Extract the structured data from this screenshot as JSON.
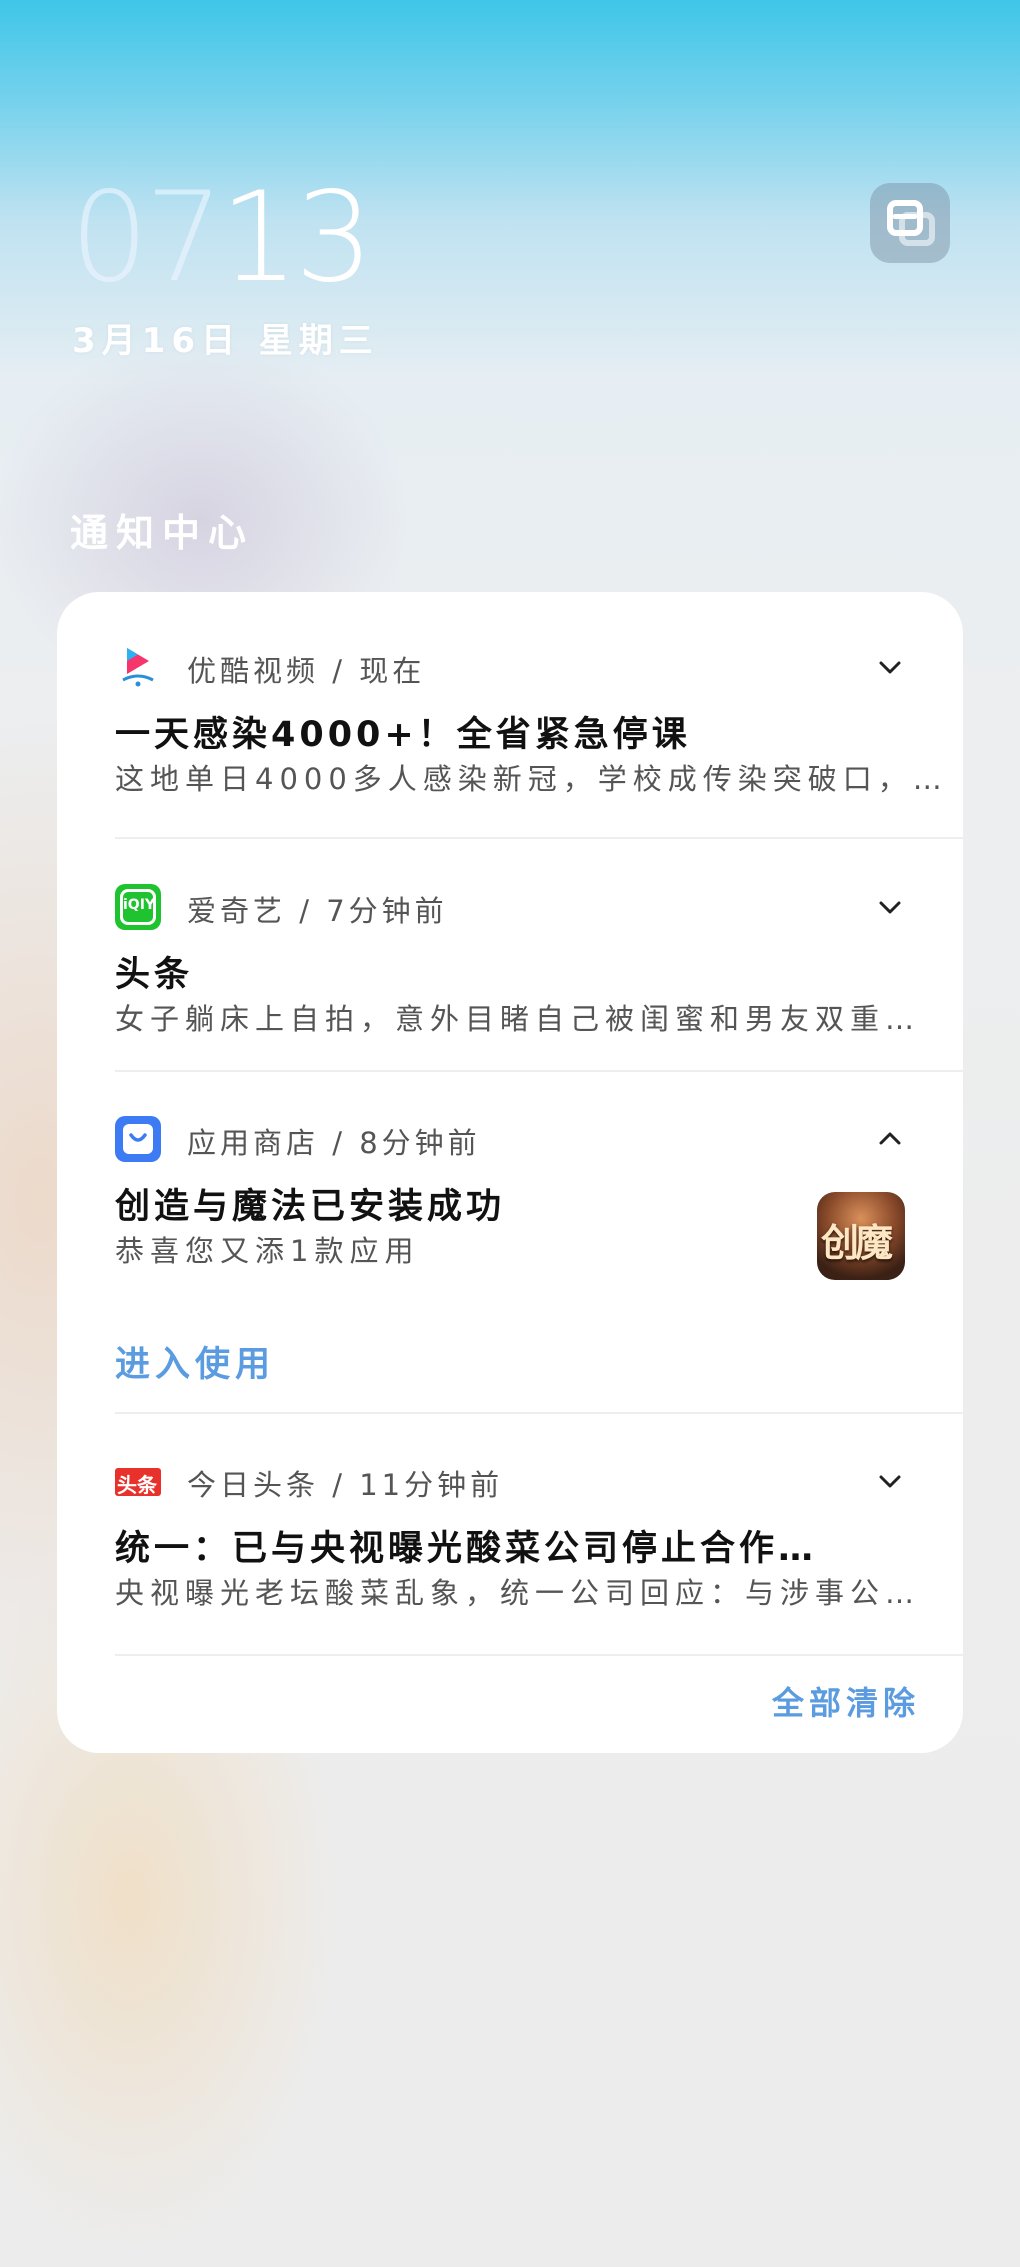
{
  "lockscreen": {
    "time_hours": "07",
    "time_minutes": "13",
    "date": "3月16日 星期三"
  },
  "notification_center": {
    "title": "通知中心",
    "notifications": [
      {
        "app": "优酷视频",
        "time": "现在",
        "meta": "优酷视频 / 现在",
        "title": "一天感染4000+！全省紧急停课",
        "body": "这地单日4000多人感染新冠，学校成传染突破口，…",
        "icon": "youku-icon",
        "expanded": false
      },
      {
        "app": "爱奇艺",
        "time": "7分钟前",
        "meta": "爱奇艺 / 7分钟前",
        "title": "头条",
        "body": "女子躺床上自拍，意外目睹自己被闺蜜和男友双重…",
        "icon": "iqiyi-icon",
        "icon_text": "iQIY",
        "expanded": false
      },
      {
        "app": "应用商店",
        "time": "8分钟前",
        "meta": "应用商店 / 8分钟前",
        "title": "创造与魔法已安装成功",
        "body": "恭喜您又添1款应用",
        "icon": "app-store-icon",
        "thumbnail_text": "创魔",
        "action": "进入使用",
        "expanded": true
      },
      {
        "app": "今日头条",
        "time": "11分钟前",
        "meta": "今日头条 / 11分钟前",
        "title": "统一：已与央视曝光酸菜公司停止合作…",
        "body": "央视曝光老坛酸菜乱象，统一公司回应：与涉事公…",
        "icon": "toutiao-icon",
        "icon_text": "头条",
        "expanded": false
      }
    ],
    "clear_all": "全部清除"
  },
  "colors": {
    "accent": "#5b9be0",
    "card_bg": "#ffffff",
    "iqiyi": "#1fc32f",
    "app_store": "#3d7bf5",
    "toutiao": "#e8312b"
  }
}
